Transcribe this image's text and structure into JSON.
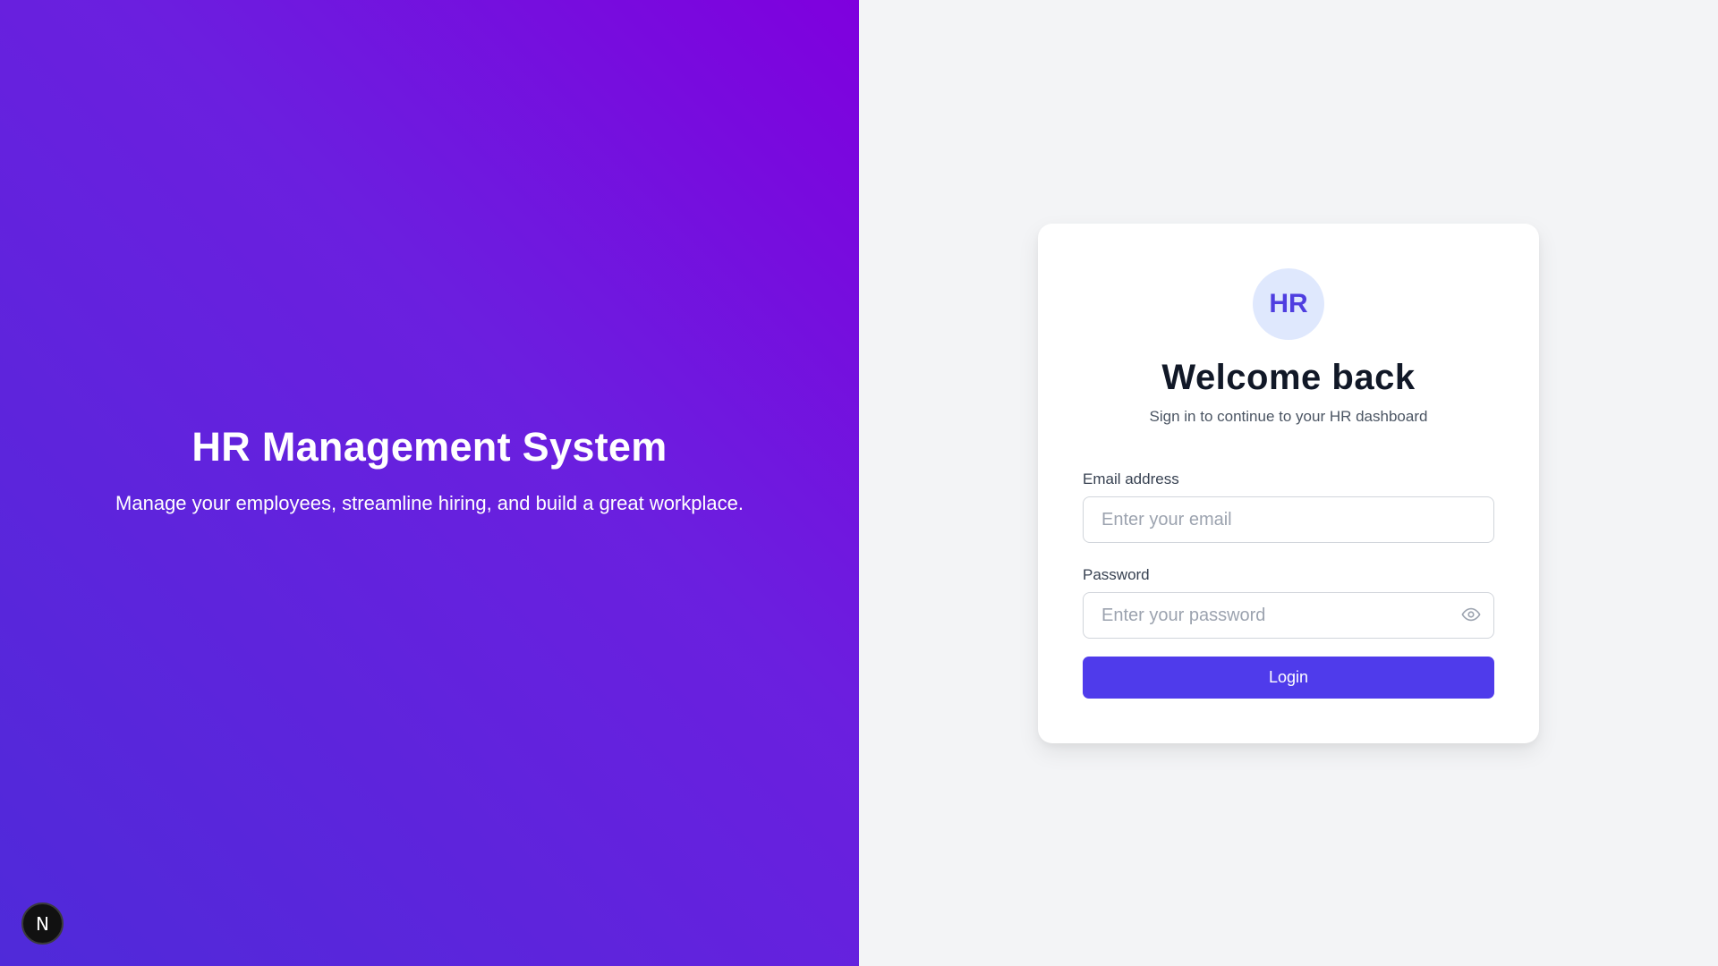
{
  "hero": {
    "title": "HR Management System",
    "subtitle": "Manage your employees, streamline hiring, and build a great workplace."
  },
  "badge": {
    "letter": "N",
    "icon": "next-logo-icon"
  },
  "login_card": {
    "logo_text": "HR",
    "title": "Welcome back",
    "subtitle": "Sign in to continue to your HR dashboard",
    "email": {
      "label": "Email address",
      "placeholder": "Enter your email",
      "value": ""
    },
    "password": {
      "label": "Password",
      "placeholder": "Enter your password",
      "value": "",
      "toggle_icon": "eye-icon"
    },
    "login_label": "Login"
  },
  "colors": {
    "gradient_start": "#4f2ad9",
    "gradient_end": "#7f00de",
    "primary_button": "#4f3beb",
    "logo_bg": "#dfe8fd",
    "logo_text": "#4f3ee0",
    "page_bg": "#f3f4f6"
  }
}
